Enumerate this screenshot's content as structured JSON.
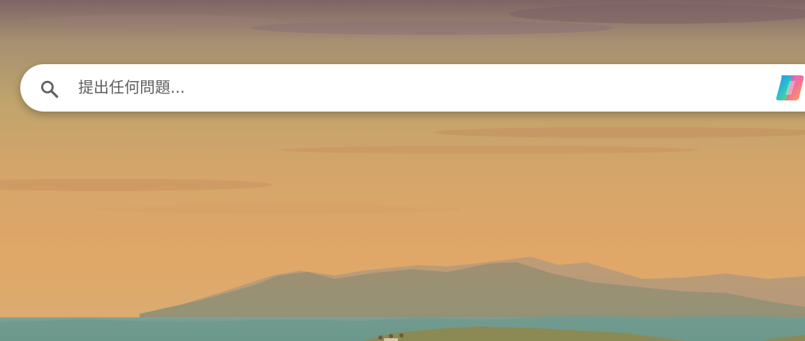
{
  "search": {
    "placeholder": "提出任何問題...",
    "value": ""
  },
  "icons": {
    "search": "search-icon",
    "copilot": "copilot-icon"
  },
  "colors": {
    "search_background": "#ffffff",
    "placeholder_text": "#5f5f5f",
    "search_icon": "#5f6368"
  }
}
